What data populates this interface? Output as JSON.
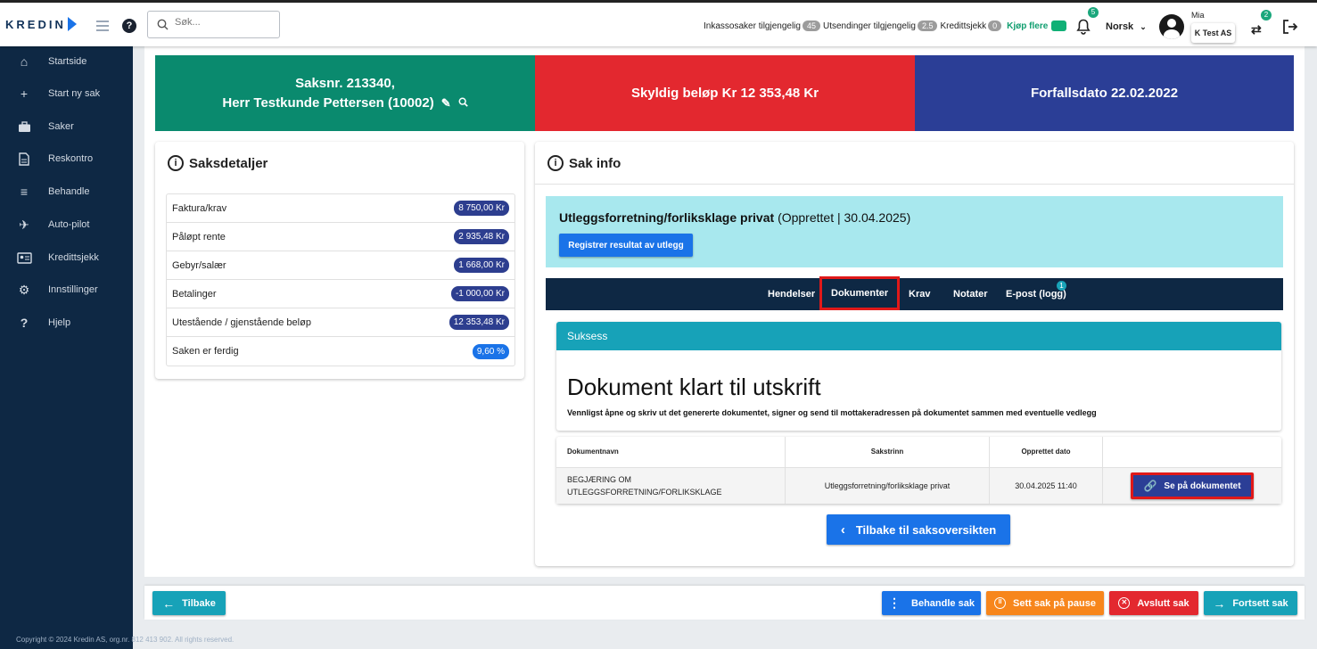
{
  "header": {
    "logo": "KREDIN",
    "search_placeholder": "Søk...",
    "stats": [
      {
        "label": "Inkassosaker tilgjengelig",
        "count": "45"
      },
      {
        "label": "Utsendinger tilgjengelig",
        "count": "2.5"
      },
      {
        "label": "Kredittsjekk",
        "count": "0"
      }
    ],
    "buy_more": "Kjøp flere",
    "notifications_count": "5",
    "language": "Norsk",
    "user_name": "Mia",
    "company": "K Test AS",
    "switch_count": "2"
  },
  "sidebar": {
    "items": [
      {
        "label": "Startside",
        "icon": "home-icon"
      },
      {
        "label": "Start ny sak",
        "icon": "plus-icon"
      },
      {
        "label": "Saker",
        "icon": "briefcase-icon"
      },
      {
        "label": "Reskontro",
        "icon": "document-icon"
      },
      {
        "label": "Behandle",
        "icon": "process-icon"
      },
      {
        "label": "Auto-pilot",
        "icon": "airplane-icon"
      },
      {
        "label": "Kredittsjekk",
        "icon": "id-card-icon"
      },
      {
        "label": "Innstillinger",
        "icon": "gear-icon"
      },
      {
        "label": "Hjelp",
        "icon": "question-icon"
      }
    ],
    "copyright": "Copyright © 2024 Kredin AS, org.nr. 812 413 902. All rights reserved."
  },
  "banners": {
    "case_line1": "Saksnr. 213340,",
    "case_line2": "Herr Testkunde Pettersen (10002)",
    "amount": "Skyldig beløp Kr 12 353,48 Kr",
    "due": "Forfallsdato  22.02.2022",
    "colors": {
      "case": "#0a8a6e",
      "amount": "#e3282f",
      "due": "#2b3e96"
    }
  },
  "details": {
    "title": "Saksdetaljer",
    "rows": [
      {
        "label": "Faktura/krav",
        "value": "8 750,00 Kr"
      },
      {
        "label": "Påløpt rente",
        "value": "2 935,48 Kr"
      },
      {
        "label": "Gebyr/salær",
        "value": "1 668,00 Kr"
      },
      {
        "label": "Betalinger",
        "value": "-1 000,00 Kr"
      },
      {
        "label": "Utestående / gjenstående beløp",
        "value": "12 353,48 Kr"
      },
      {
        "label": "Saken er ferdig",
        "value": "9,60 %"
      }
    ]
  },
  "info": {
    "title": "Sak info",
    "step_title": "Utleggsforretning/forlikskl­age privat",
    "step_meta": "(Opprettet | 30.04.2025)",
    "register_button": "Registrer resultat av utlegg",
    "tabs": [
      "Hendelser",
      "Dokumenter",
      "Krav",
      "Notater",
      "E-post (logg)"
    ],
    "email_badge": "1",
    "success_header": "Suksess",
    "success_title": "Dokument klart til utskrift",
    "success_message": "Vennligst åpne og skriv ut det genererte dokumentet, signer og send til mottakeradressen på dokumentet sammen med eventuelle vedlegg",
    "table": {
      "headers": [
        "Dokumentnavn",
        "Sakstrinn",
        "Opprettet dato",
        ""
      ],
      "row": {
        "name": "BEGJÆRING OM UTLEGGSFORRETNING/FORLIKSKLAGE",
        "step": "Utleggsforretning/forliksklage privat",
        "date": "30.04.2025 11:40",
        "button": "Se på dokumentet"
      }
    },
    "back_to_overview": "Tilbake til saksoversikten"
  },
  "footer": {
    "back": "Tilbake",
    "process": "Behandle sak",
    "pause": "Sett sak på pause",
    "close": "Avslutt sak",
    "continue": "Fortsett sak"
  }
}
